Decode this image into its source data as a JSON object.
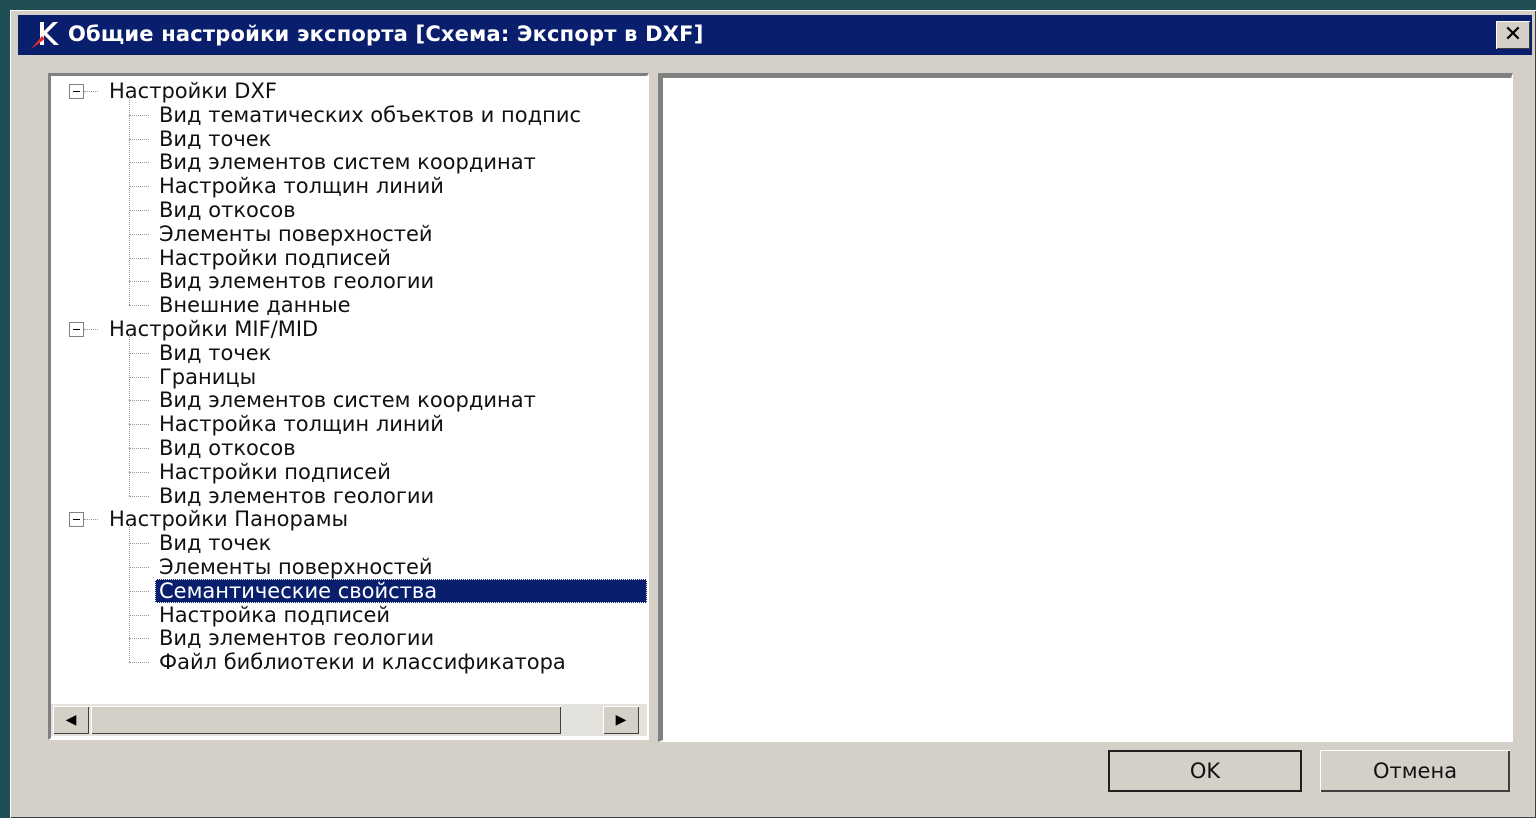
{
  "window": {
    "title": "Общие настройки экспорта [Схема: Экспорт в DXF]",
    "close_glyph": "✕"
  },
  "tree": {
    "groups": [
      {
        "label": "Настройки DXF",
        "items": [
          "Вид тематических объектов и подпис",
          "Вид точек",
          "Вид элементов систем координат",
          "Настройка толщин линий",
          "Вид откосов",
          "Элементы поверхностей",
          "Настройки подписей",
          "Вид элементов геологии",
          "Внешние данные"
        ]
      },
      {
        "label": "Настройки MIF/MID",
        "items": [
          "Вид точек",
          "Границы",
          "Вид элементов систем координат",
          "Настройка толщин линий",
          "Вид откосов",
          "Настройки подписей",
          "Вид элементов геологии"
        ]
      },
      {
        "label": "Настройки Панорамы",
        "items": [
          "Вид точек",
          "Элементы поверхностей",
          "Семантические свойства",
          "Настройка подписей",
          "Вид элементов геологии",
          "Файл библиотеки и классификатора"
        ]
      }
    ],
    "selected": {
      "group": 2,
      "item": 2
    }
  },
  "buttons": {
    "ok": "OK",
    "cancel": "Отмена"
  },
  "icons": {
    "app": "k-logo-icon",
    "expander": "minus-box-icon",
    "scroll_left": "◀",
    "scroll_right": "▶"
  },
  "colors": {
    "titlebar": "#0a1e6e",
    "selection": "#0a1e6e",
    "dialog": "#d4d0c8",
    "desktop": "#1f4f55"
  }
}
